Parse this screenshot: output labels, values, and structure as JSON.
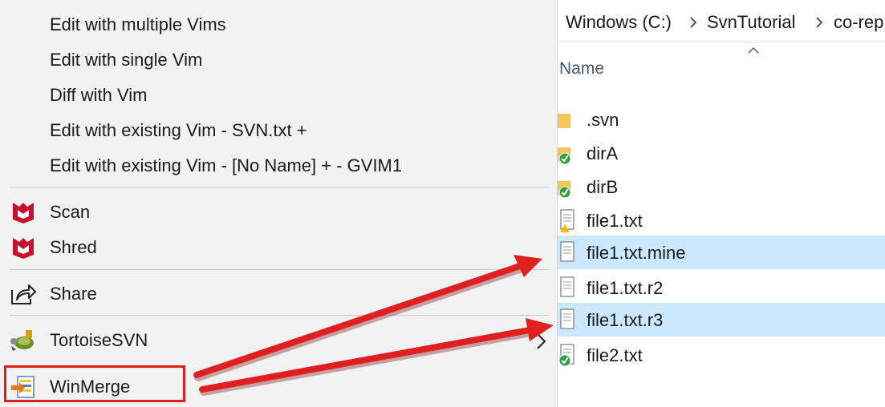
{
  "context_menu": {
    "items": [
      {
        "label": "Edit with multiple Vims"
      },
      {
        "label": "Edit with single Vim"
      },
      {
        "label": "Diff with Vim"
      },
      {
        "label": "Edit with existing Vim - SVN.txt +"
      },
      {
        "label": "Edit with existing Vim - [No Name] + - GVIM1"
      },
      {
        "label": "Scan",
        "icon": "mcafee-icon"
      },
      {
        "label": "Shred",
        "icon": "mcafee-icon"
      },
      {
        "label": "Share",
        "icon": "share-icon"
      },
      {
        "label": "TortoiseSVN",
        "icon": "tortoisesvn-icon",
        "has_submenu": true
      },
      {
        "label": "WinMerge",
        "icon": "winmerge-icon",
        "highlighted": true
      }
    ]
  },
  "explorer": {
    "breadcrumb": [
      "Windows (C:)",
      "SvnTutorial",
      "co-rep"
    ],
    "column_header": "Name",
    "files": [
      {
        "name": ".svn",
        "type": "folder",
        "status": "none",
        "selected": false
      },
      {
        "name": "dirA",
        "type": "folder",
        "status": "normal",
        "selected": false
      },
      {
        "name": "dirB",
        "type": "folder",
        "status": "normal",
        "selected": false
      },
      {
        "name": "file1.txt",
        "type": "file",
        "status": "conflict",
        "selected": false
      },
      {
        "name": "file1.txt.mine",
        "type": "file",
        "status": "none",
        "selected": true
      },
      {
        "name": "file1.txt.r2",
        "type": "file",
        "status": "none",
        "selected": false
      },
      {
        "name": "file1.txt.r3",
        "type": "file",
        "status": "none",
        "selected": true
      },
      {
        "name": "file2.txt",
        "type": "file",
        "status": "normal",
        "selected": false
      }
    ]
  },
  "colors": {
    "menu_background": "#f2f2f2",
    "selection": "#cce8ff",
    "annotation_red": "#e02020",
    "mcafee_red": "#c8102e",
    "svn_ok_green": "#2e9e3e"
  }
}
